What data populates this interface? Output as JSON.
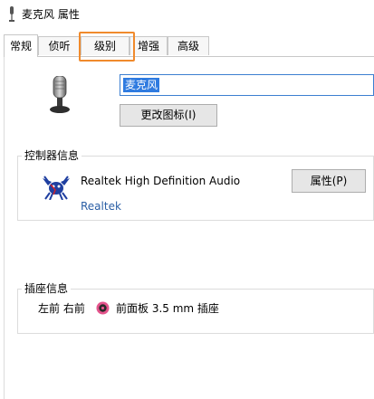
{
  "window": {
    "title": "麦克风 属性",
    "icon": "microphone-icon"
  },
  "tabs": [
    {
      "label": "常规",
      "active": true
    },
    {
      "label": "侦听",
      "active": false
    },
    {
      "label": "级别",
      "active": false,
      "highlighted": true
    },
    {
      "label": "增强",
      "active": false
    },
    {
      "label": "高级",
      "active": false
    }
  ],
  "device": {
    "icon": "microphone-icon",
    "name_value": "麦克风",
    "change_icon_label": "更改图标(I)"
  },
  "controller": {
    "group_title": "控制器信息",
    "name": "Realtek High Definition Audio",
    "vendor_link": "Realtek",
    "properties_label": "属性(P)",
    "logo": "realtek-crab-logo"
  },
  "jack": {
    "group_title": "插座信息",
    "position": "左前 右前",
    "description": "前面板 3.5 mm 插座",
    "icon": "audio-jack-icon",
    "jack_color": "#e4548c"
  },
  "colors": {
    "highlight_box": "#f08a2c",
    "selection": "#2f7be0",
    "link": "#2a5ea5"
  }
}
